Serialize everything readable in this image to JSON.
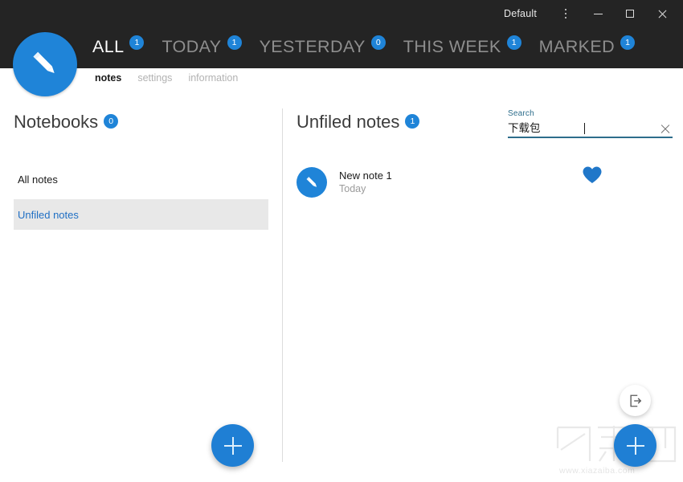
{
  "window": {
    "profile_label": "Default",
    "menu_icon": "kebab-menu-icon",
    "minimize_label": "–",
    "maximize_label": "□",
    "close_label": "✕"
  },
  "brand": {
    "logo_icon": "pencil-logo-icon",
    "accent_color": "#1f84d8",
    "header_bg": "#242424",
    "selected_row_bg": "#e8e8e8",
    "search_accent": "#2d6d8b"
  },
  "filters": [
    {
      "label": "ALL",
      "count": "1",
      "active": true
    },
    {
      "label": "TODAY",
      "count": "1",
      "active": false
    },
    {
      "label": "YESTERDAY",
      "count": "0",
      "active": false
    },
    {
      "label": "THIS WEEK",
      "count": "1",
      "active": false
    },
    {
      "label": "MARKED",
      "count": "1",
      "active": false
    }
  ],
  "subnav": [
    {
      "label": "notes",
      "active": true
    },
    {
      "label": "settings",
      "active": false
    },
    {
      "label": "information",
      "active": false
    }
  ],
  "notebooks": {
    "title": "Notebooks",
    "count": "0",
    "items": [
      {
        "label": "All notes",
        "selected": false
      },
      {
        "label": "Unfiled notes",
        "selected": true
      }
    ],
    "add_button_label": "+"
  },
  "notes_pane": {
    "title": "Unfiled notes",
    "count": "1",
    "items": [
      {
        "title": "New note 1",
        "subtitle": "Today",
        "icon": "pencil-note-icon"
      }
    ]
  },
  "search": {
    "label": "Search",
    "value": "下载包",
    "placeholder": "Search",
    "clear_icon": "close-icon"
  },
  "favorite": {
    "icon": "heart-icon",
    "color": "#2077c9"
  },
  "actions": {
    "export_icon": "export-arrow-icon",
    "add_note_label": "+"
  },
  "watermark": {
    "text": "下载吧",
    "url": "www.xiazaiba.com"
  }
}
